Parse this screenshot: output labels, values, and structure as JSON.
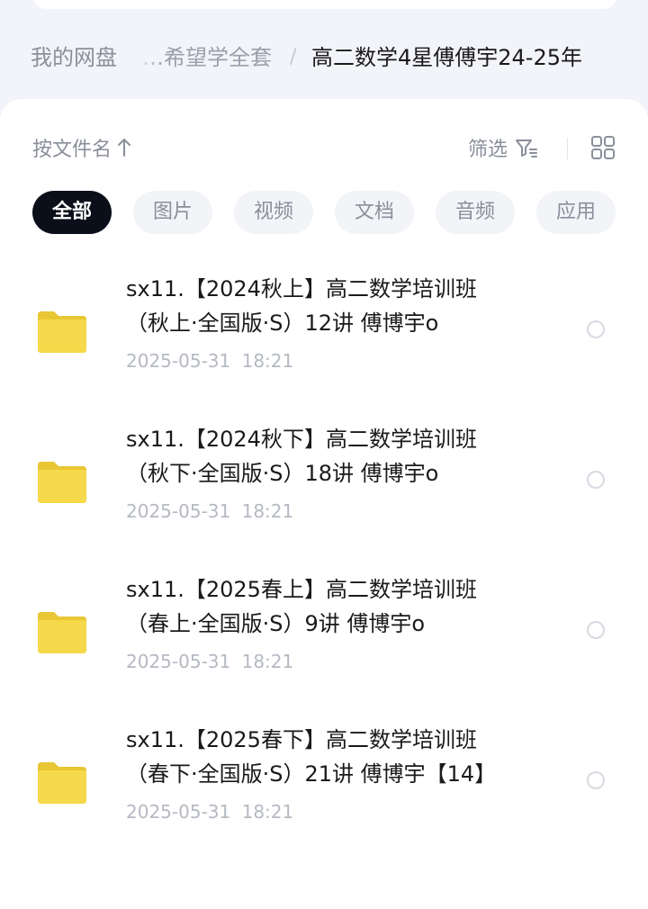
{
  "breadcrumb": {
    "root": "我的网盘",
    "middle": "…希望学全套",
    "separator": "/",
    "current": "高二数学4星傅傅宇24-25年"
  },
  "toolbar": {
    "sort_label": "按文件名",
    "sort_icon": "arrow-up-icon",
    "filter_label": "筛选",
    "filter_icon": "filter-icon",
    "view_icon": "grid-view-icon"
  },
  "tabs": [
    {
      "label": "全部",
      "active": true
    },
    {
      "label": "图片",
      "active": false
    },
    {
      "label": "视频",
      "active": false
    },
    {
      "label": "文档",
      "active": false
    },
    {
      "label": "音频",
      "active": false
    },
    {
      "label": "应用",
      "active": false
    }
  ],
  "files": [
    {
      "name_line1": "sx11.【2024秋上】高二数学培训班",
      "name_line2": "（秋上·全国版·S）12讲 傅博宇o",
      "date": "2025-05-31 18:21",
      "icon": "folder-icon",
      "selected": false
    },
    {
      "name_line1": "sx11.【2024秋下】高二数学培训班",
      "name_line2": "（秋下·全国版·S）18讲 傅博宇o",
      "date": "2025-05-31 18:21",
      "icon": "folder-icon",
      "selected": false
    },
    {
      "name_line1": "sx11.【2025春上】高二数学培训班",
      "name_line2": "（春上·全国版·S）9讲 傅博宇o",
      "date": "2025-05-31 18:21",
      "icon": "folder-icon",
      "selected": false
    },
    {
      "name_line1": "sx11.【2025春下】高二数学培训班",
      "name_line2": "（春下·全国版·S）21讲 傅博宇【14】",
      "date": "2025-05-31 18:21",
      "icon": "folder-icon",
      "selected": false
    }
  ],
  "colors": {
    "background": "#f2f4f9",
    "panel": "#ffffff",
    "active_tab": "#0b0f1a",
    "folder": "#f6d94a"
  }
}
